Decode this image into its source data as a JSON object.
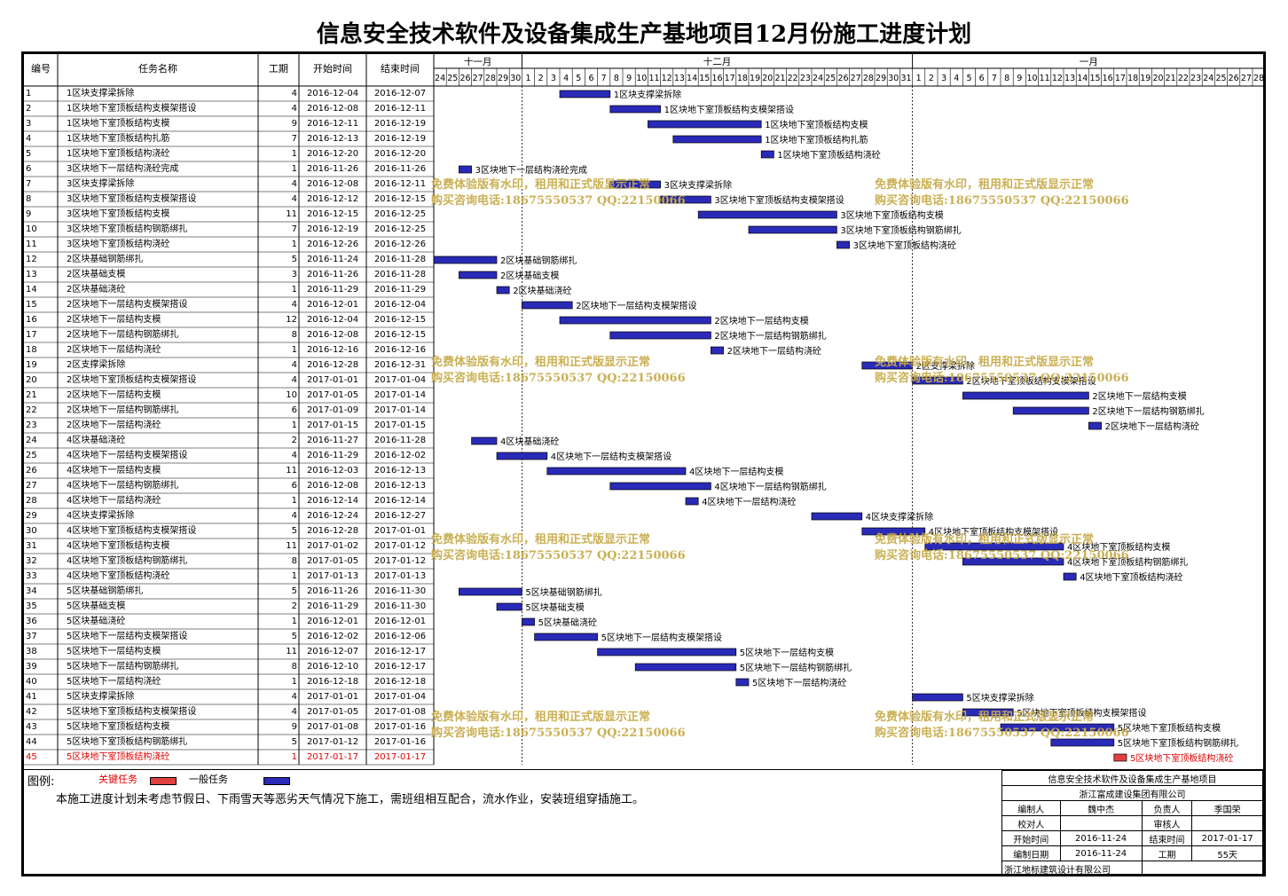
{
  "title": "信息安全技术软件及设备集成生产基地项目12月份施工进度计划",
  "headers": {
    "id": "编号",
    "name": "任务名称",
    "dur": "工期",
    "start": "开始时间",
    "end": "结束时间"
  },
  "months": [
    "十一月",
    "十二月",
    "一月"
  ],
  "days": [
    "24",
    "25",
    "26",
    "27",
    "28",
    "29",
    "30",
    "1",
    "2",
    "3",
    "4",
    "5",
    "6",
    "7",
    "8",
    "9",
    "10",
    "11",
    "12",
    "13",
    "14",
    "15",
    "16",
    "17",
    "18",
    "19",
    "20",
    "21",
    "22",
    "23",
    "24",
    "25",
    "26",
    "27",
    "28",
    "29",
    "30",
    "31",
    "1",
    "2",
    "3",
    "4",
    "5",
    "6",
    "7",
    "8",
    "9",
    "10",
    "11",
    "12",
    "13",
    "14",
    "15",
    "16",
    "17",
    "18",
    "19",
    "20",
    "21",
    "22",
    "23",
    "24",
    "25",
    "26",
    "27",
    "28"
  ],
  "tasks": [
    {
      "id": "1",
      "name": "1区块支撑梁拆除",
      "dur": "4",
      "start": "2016-12-04",
      "end": "2016-12-07",
      "s": 10,
      "d": 4
    },
    {
      "id": "2",
      "name": "1区块地下室顶板结构支模架搭设",
      "dur": "4",
      "start": "2016-12-08",
      "end": "2016-12-11",
      "s": 14,
      "d": 4
    },
    {
      "id": "3",
      "name": "1区块地下室顶板结构支模",
      "dur": "9",
      "start": "2016-12-11",
      "end": "2016-12-19",
      "s": 17,
      "d": 9
    },
    {
      "id": "4",
      "name": "1区块地下室顶板结构扎筋",
      "dur": "7",
      "start": "2016-12-13",
      "end": "2016-12-19",
      "s": 19,
      "d": 7
    },
    {
      "id": "5",
      "name": "1区块地下室顶板结构浇砼",
      "dur": "1",
      "start": "2016-12-20",
      "end": "2016-12-20",
      "s": 26,
      "d": 1
    },
    {
      "id": "6",
      "name": "3区块地下一层结构浇砼完成",
      "dur": "1",
      "start": "2016-11-26",
      "end": "2016-11-26",
      "s": 2,
      "d": 1
    },
    {
      "id": "7",
      "name": "3区块支撑梁拆除",
      "dur": "4",
      "start": "2016-12-08",
      "end": "2016-12-11",
      "s": 14,
      "d": 4
    },
    {
      "id": "8",
      "name": "3区块地下室顶板结构支模架搭设",
      "dur": "4",
      "start": "2016-12-12",
      "end": "2016-12-15",
      "s": 18,
      "d": 4
    },
    {
      "id": "9",
      "name": "3区块地下室顶板结构支模",
      "dur": "11",
      "start": "2016-12-15",
      "end": "2016-12-25",
      "s": 21,
      "d": 11
    },
    {
      "id": "10",
      "name": "3区块地下室顶板结构钢筋绑扎",
      "dur": "7",
      "start": "2016-12-19",
      "end": "2016-12-25",
      "s": 25,
      "d": 7
    },
    {
      "id": "11",
      "name": "3区块地下室顶板结构浇砼",
      "dur": "1",
      "start": "2016-12-26",
      "end": "2016-12-26",
      "s": 32,
      "d": 1
    },
    {
      "id": "12",
      "name": "2区块基础钢筋绑扎",
      "dur": "5",
      "start": "2016-11-24",
      "end": "2016-11-28",
      "s": 0,
      "d": 5
    },
    {
      "id": "13",
      "name": "2区块基础支模",
      "dur": "3",
      "start": "2016-11-26",
      "end": "2016-11-28",
      "s": 2,
      "d": 3
    },
    {
      "id": "14",
      "name": "2区块基础浇砼",
      "dur": "1",
      "start": "2016-11-29",
      "end": "2016-11-29",
      "s": 5,
      "d": 1
    },
    {
      "id": "15",
      "name": "2区块地下一层结构支模架搭设",
      "dur": "4",
      "start": "2016-12-01",
      "end": "2016-12-04",
      "s": 7,
      "d": 4
    },
    {
      "id": "16",
      "name": "2区块地下一层结构支模",
      "dur": "12",
      "start": "2016-12-04",
      "end": "2016-12-15",
      "s": 10,
      "d": 12
    },
    {
      "id": "17",
      "name": "2区块地下一层结构钢筋绑扎",
      "dur": "8",
      "start": "2016-12-08",
      "end": "2016-12-15",
      "s": 14,
      "d": 8
    },
    {
      "id": "18",
      "name": "2区块地下一层结构浇砼",
      "dur": "1",
      "start": "2016-12-16",
      "end": "2016-12-16",
      "s": 22,
      "d": 1
    },
    {
      "id": "19",
      "name": "2区支撑梁拆除",
      "dur": "4",
      "start": "2016-12-28",
      "end": "2016-12-31",
      "s": 34,
      "d": 4
    },
    {
      "id": "20",
      "name": "2区块地下室顶板结构支模架搭设",
      "dur": "4",
      "start": "2017-01-01",
      "end": "2017-01-04",
      "s": 38,
      "d": 4
    },
    {
      "id": "21",
      "name": "2区块地下一层结构支模",
      "dur": "10",
      "start": "2017-01-05",
      "end": "2017-01-14",
      "s": 42,
      "d": 10
    },
    {
      "id": "22",
      "name": "2区块地下一层结构钢筋绑扎",
      "dur": "6",
      "start": "2017-01-09",
      "end": "2017-01-14",
      "s": 46,
      "d": 6
    },
    {
      "id": "23",
      "name": "2区块地下一层结构浇砼",
      "dur": "1",
      "start": "2017-01-15",
      "end": "2017-01-15",
      "s": 52,
      "d": 1
    },
    {
      "id": "24",
      "name": "4区块基础浇砼",
      "dur": "2",
      "start": "2016-11-27",
      "end": "2016-11-28",
      "s": 3,
      "d": 2
    },
    {
      "id": "25",
      "name": "4区块地下一层结构支模架搭设",
      "dur": "4",
      "start": "2016-11-29",
      "end": "2016-12-02",
      "s": 5,
      "d": 4
    },
    {
      "id": "26",
      "name": "4区块地下一层结构支模",
      "dur": "11",
      "start": "2016-12-03",
      "end": "2016-12-13",
      "s": 9,
      "d": 11
    },
    {
      "id": "27",
      "name": "4区块地下一层结构钢筋绑扎",
      "dur": "6",
      "start": "2016-12-08",
      "end": "2016-12-13",
      "s": 14,
      "d": 8
    },
    {
      "id": "28",
      "name": "4区块地下一层结构浇砼",
      "dur": "1",
      "start": "2016-12-14",
      "end": "2016-12-14",
      "s": 20,
      "d": 1
    },
    {
      "id": "29",
      "name": "4区块支撑梁拆除",
      "dur": "4",
      "start": "2016-12-24",
      "end": "2016-12-27",
      "s": 30,
      "d": 4
    },
    {
      "id": "30",
      "name": "4区块地下室顶板结构支模架搭设",
      "dur": "5",
      "start": "2016-12-28",
      "end": "2017-01-01",
      "s": 34,
      "d": 5
    },
    {
      "id": "31",
      "name": "4区块地下室顶板结构支模",
      "dur": "11",
      "start": "2017-01-02",
      "end": "2017-01-12",
      "s": 39,
      "d": 11
    },
    {
      "id": "32",
      "name": "4区块地下室顶板结构钢筋绑扎",
      "dur": "8",
      "start": "2017-01-05",
      "end": "2017-01-12",
      "s": 42,
      "d": 8
    },
    {
      "id": "33",
      "name": "4区块地下室顶板结构浇砼",
      "dur": "1",
      "start": "2017-01-13",
      "end": "2017-01-13",
      "s": 50,
      "d": 1
    },
    {
      "id": "34",
      "name": "5区块基础钢筋绑扎",
      "dur": "5",
      "start": "2016-11-26",
      "end": "2016-11-30",
      "s": 2,
      "d": 5
    },
    {
      "id": "35",
      "name": "5区块基础支模",
      "dur": "2",
      "start": "2016-11-29",
      "end": "2016-11-30",
      "s": 5,
      "d": 2
    },
    {
      "id": "36",
      "name": "5区块基础浇砼",
      "dur": "1",
      "start": "2016-12-01",
      "end": "2016-12-01",
      "s": 7,
      "d": 1
    },
    {
      "id": "37",
      "name": "5区块地下一层结构支模架搭设",
      "dur": "5",
      "start": "2016-12-02",
      "end": "2016-12-06",
      "s": 8,
      "d": 5
    },
    {
      "id": "38",
      "name": "5区块地下一层结构支模",
      "dur": "11",
      "start": "2016-12-07",
      "end": "2016-12-17",
      "s": 13,
      "d": 11
    },
    {
      "id": "39",
      "name": "5区块地下一层结构钢筋绑扎",
      "dur": "8",
      "start": "2016-12-10",
      "end": "2016-12-17",
      "s": 16,
      "d": 8
    },
    {
      "id": "40",
      "name": "5区块地下一层结构浇砼",
      "dur": "1",
      "start": "2016-12-18",
      "end": "2016-12-18",
      "s": 24,
      "d": 1
    },
    {
      "id": "41",
      "name": "5区块支撑梁拆除",
      "dur": "4",
      "start": "2017-01-01",
      "end": "2017-01-04",
      "s": 38,
      "d": 4
    },
    {
      "id": "42",
      "name": "5区块地下室顶板结构支模架搭设",
      "dur": "4",
      "start": "2017-01-05",
      "end": "2017-01-08",
      "s": 42,
      "d": 4
    },
    {
      "id": "43",
      "name": "5区块地下室顶板结构支模",
      "dur": "9",
      "start": "2017-01-08",
      "end": "2017-01-16",
      "s": 45,
      "d": 9
    },
    {
      "id": "44",
      "name": "5区块地下室顶板结构钢筋绑扎",
      "dur": "5",
      "start": "2017-01-12",
      "end": "2017-01-16",
      "s": 49,
      "d": 5
    },
    {
      "id": "45",
      "name": "5区块地下室顶板结构浇砼",
      "dur": "1",
      "start": "2017-01-17",
      "end": "2017-01-17",
      "s": 54,
      "d": 1,
      "critical": true
    }
  ],
  "watermark": {
    "line1": "免费体验版有水印，租用和正式版显示正常",
    "line2": "购买咨询电话:18675550537 QQ:22150066"
  },
  "legend": {
    "label": "图例:",
    "critical": "关键任务",
    "normal": "一般任务",
    "critical_color": "#e04040",
    "normal_color": "#2a2ab8"
  },
  "note": "本施工进度计划未考虑节假日、下雨雪天等恶劣天气情况下施工，需班组相互配合，流水作业，安装班组穿插施工。",
  "signoff": {
    "project": "信息安全技术软件及设备集成生产基地项目",
    "company": "浙江富成建设集团有限公司",
    "editor_label": "编制人",
    "editor": "魏中杰",
    "owner_label": "负责人",
    "owner": "季国荣",
    "checker_label": "校对人",
    "checker": "",
    "reviewer_label": "审核人",
    "reviewer": "",
    "start_label": "开始时间",
    "start": "2016-11-24",
    "end_label": "结束时间",
    "end": "2017-01-17",
    "date_label": "编制日期",
    "date": "2016-11-24",
    "dur_label": "工期",
    "dur": "55天",
    "designer": "浙江地标建筑设计有限公司"
  }
}
